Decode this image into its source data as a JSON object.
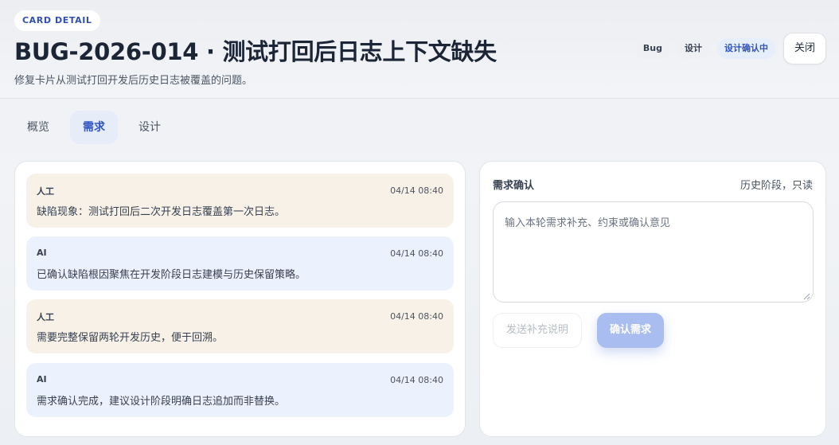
{
  "header": {
    "eyebrow": "CARD DETAIL",
    "title": "BUG-2026-014 · 测试打回后日志上下文缺失",
    "subtitle": "修复卡片从测试打回开发后历史日志被覆盖的问题。",
    "tags": [
      "Bug",
      "设计",
      "设计确认中"
    ],
    "close_label": "关闭"
  },
  "tabs": [
    {
      "label": "概览",
      "active": false
    },
    {
      "label": "需求",
      "active": true
    },
    {
      "label": "设计",
      "active": false
    }
  ],
  "messages": [
    {
      "role": "人工",
      "time": "04/14 08:40",
      "text": "缺陷现象：测试打回后二次开发日志覆盖第一次日志。"
    },
    {
      "role": "AI",
      "time": "04/14 08:40",
      "text": "已确认缺陷根因聚焦在开发阶段日志建模与历史保留策略。"
    },
    {
      "role": "人工",
      "time": "04/14 08:40",
      "text": "需要完整保留两轮开发历史，便于回溯。"
    },
    {
      "role": "AI",
      "time": "04/14 08:40",
      "text": "需求确认完成，建议设计阶段明确日志追加而非替换。"
    }
  ],
  "confirm_panel": {
    "title": "需求确认",
    "note": "历史阶段，只读",
    "input_value": "",
    "input_placeholder": "输入本轮需求补充、约束或确认意见",
    "send_label": "发送补充说明",
    "confirm_label": "确认需求"
  },
  "colors": {
    "accent": "#2f55c0",
    "human_bubble": "#f7f1e8",
    "ai_bubble": "#ebf1fd",
    "primary_button": "#a9bdf0"
  }
}
